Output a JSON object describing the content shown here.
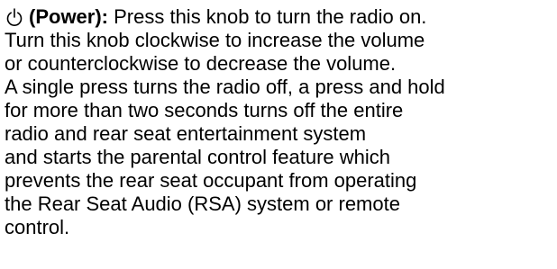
{
  "entry": {
    "icon": "power-icon",
    "term": "(Power):",
    "lines": [
      " Press this knob to turn the radio on.",
      "Turn this knob clockwise to increase the volume",
      "or counterclockwise to decrease the volume.",
      "A single press turns the radio off, a press and hold",
      "for more than two seconds turns off the entire",
      "radio and rear seat entertainment system",
      "and starts the parental control feature which",
      "prevents the rear seat occupant from operating",
      "the Rear Seat Audio (RSA) system or remote",
      "control."
    ]
  }
}
